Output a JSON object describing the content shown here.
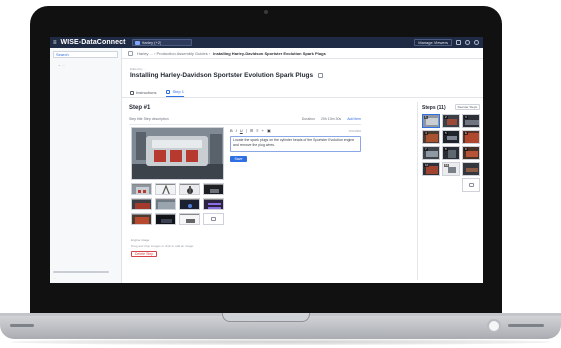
{
  "app": {
    "brand": "WISE-DataConnect",
    "doc_tab": "Harley (+2)",
    "manage_label": "Manage Viewers",
    "menu_glyph": "≡"
  },
  "sidebar": {
    "search_label": "Search",
    "items": [
      "⌄ ...",
      "...",
      "..."
    ],
    "footer": "..."
  },
  "breadcrumb": {
    "path": "Harley ... › Production Assembly Guides ›",
    "current": "Installing Harley-Davidson Sportster Evolution Spark Plugs"
  },
  "page": {
    "edit_note": "Edited by ...",
    "title": "Installing Harley-Davidson Sportster Evolution Spark Plugs"
  },
  "subtabs": [
    {
      "label": "Instructions"
    },
    {
      "label": "Step 1"
    }
  ],
  "step": {
    "title": "Step #1",
    "toolbar_left": "Step title   Step description",
    "toolbar_right": [
      "Duration",
      "20h  10m  30s"
    ],
    "toolbar_blue": "Add item",
    "editor_text": "Locate the spark plugs on the cylinder heads of the Sportster Evolution engine and remove the plug wires.",
    "editor_counter": "104/1000",
    "save_label": "Save",
    "caption": "Engine image",
    "hint": "Drag and drop images or click to add an image.",
    "delete_label": "Delete Step"
  },
  "steps_panel": {
    "title": "Steps (11)",
    "reorder_label": "Reorder Steps",
    "numbers": [
      "1",
      "2",
      "3",
      "4",
      "5",
      "6",
      "7",
      "8",
      "9",
      "10",
      "11"
    ]
  },
  "colors": {
    "accent": "#2f6fe4",
    "topbar": "#1f2a44",
    "danger": "#d64545"
  },
  "icons": {
    "menu": "hamburger-icon",
    "doc": "document-icon",
    "add_image": "add-image-icon"
  }
}
